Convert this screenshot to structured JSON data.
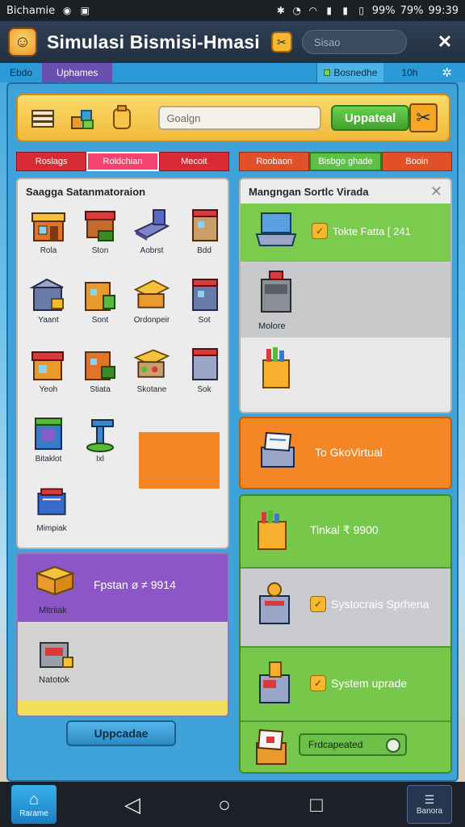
{
  "status_bar": {
    "app_name": "Bichamie",
    "battery_a": "99%",
    "battery_b": "79%",
    "time": "99:39"
  },
  "header": {
    "title": "Simulasi Bismisi-Hmasi",
    "search_placeholder": "Sisao",
    "close_icon": "close-icon"
  },
  "subbar": {
    "tab_1": "Ebdo",
    "tab_2": "Uphames",
    "tab_3": "Bosnedhe",
    "tab_4": "10h"
  },
  "toolbar": {
    "input_placeholder": "Goalgn",
    "upgrade_label": "Uppateal"
  },
  "left_tabs": [
    "Roslags",
    "Roldchian",
    "Mecoit"
  ],
  "right_tabs": [
    "Roobaon",
    "Bisbgo ghade",
    "Booin"
  ],
  "catalog": {
    "title": "Saagga Satanmatoraion",
    "items": [
      {
        "label": "Rola",
        "icon": "shop-icon"
      },
      {
        "label": "Ston",
        "icon": "market-stall-icon"
      },
      {
        "label": "Aobrst",
        "icon": "factory-icon"
      },
      {
        "label": "Bdd",
        "icon": "building-icon"
      },
      {
        "label": "Yaant",
        "icon": "warehouse-icon"
      },
      {
        "label": "Sont",
        "icon": "store-icon"
      },
      {
        "label": "Ordonpeir",
        "icon": "stall-icon"
      },
      {
        "label": "Sot",
        "icon": "building-icon"
      },
      {
        "label": "Yeoh",
        "icon": "shop-icon"
      },
      {
        "label": "Stiata",
        "icon": "store-icon"
      },
      {
        "label": "Skotane",
        "icon": "market-icon"
      },
      {
        "label": "Sok",
        "icon": "building-icon"
      },
      {
        "label": "Bitaklot",
        "icon": "tower-icon"
      },
      {
        "label": "Ixl",
        "icon": "crane-icon"
      },
      {
        "label": "Mimpiak",
        "icon": "cart-icon"
      }
    ]
  },
  "purple_panel": {
    "text": "Fpstan ø ≠ 9914",
    "label_1": "Mltriiak",
    "label_2": "Natotok"
  },
  "bottom_button": "Uppcadae",
  "right_panel": {
    "title": "Mangngan  Sortlc Virada",
    "row_1_text": "Tokte Fatta [ 241",
    "row_2_label": "Molore"
  },
  "orange_card": {
    "text": "To GkoVirtual"
  },
  "green_stack": {
    "row_1_text": "Tinkal ₹ 9900",
    "row_2_text": "Systocrais Sprhena",
    "row_3_text": "System uprade",
    "button_label": "Frdcapeated"
  },
  "navbar": {
    "home_label": "Rarame",
    "menu_label": "Banora"
  }
}
